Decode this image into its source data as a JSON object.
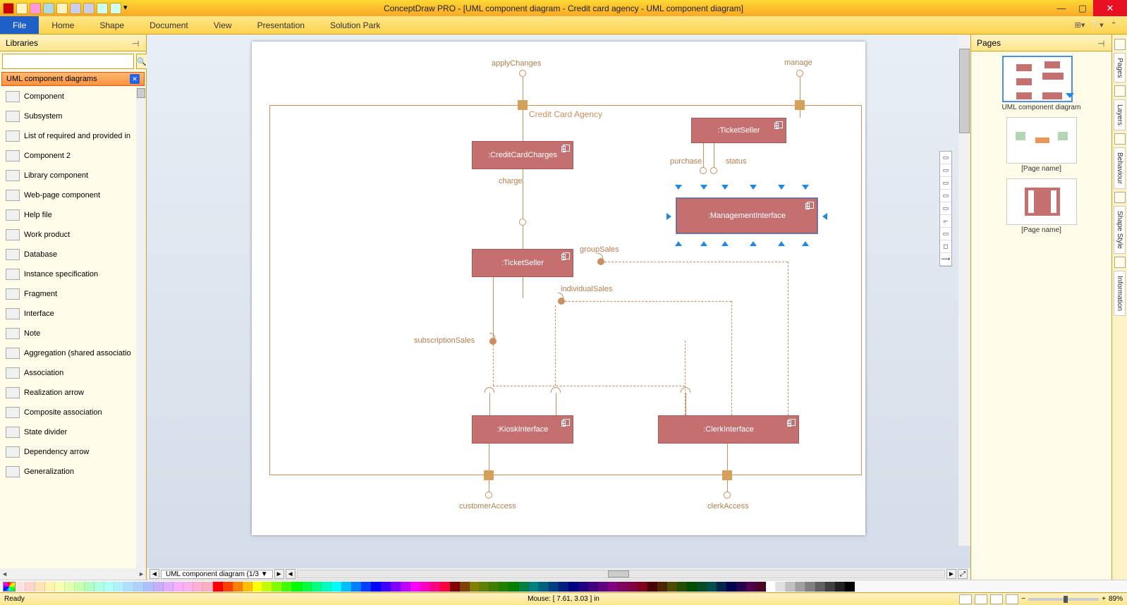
{
  "app_title": "ConceptDraw PRO - [UML component diagram - Credit card agency - UML component diagram]",
  "menu": {
    "file": "File",
    "tabs": [
      "Home",
      "Shape",
      "Document",
      "View",
      "Presentation",
      "Solution Park"
    ]
  },
  "libraries": {
    "title": "Libraries",
    "search_placeholder": "",
    "group": "UML component diagrams",
    "items": [
      "Component",
      "Subsystem",
      "List of required and provided in",
      "Component 2",
      "Library component",
      "Web-page component",
      "Help file",
      "Work product",
      "Database",
      "Instance specification",
      "Fragment",
      "Interface",
      "Note",
      "Aggregation (shared associatio",
      "Association",
      "Realization arrow",
      "Composite association",
      "State divider",
      "Dependency arrow",
      "Generalization"
    ]
  },
  "diagram": {
    "frame_title": "Credit Card Agency",
    "labels": {
      "apply": "applyChanges",
      "manage": "manage",
      "charge": "charge",
      "purchase": "purchase",
      "status": "status",
      "group": "groupSales",
      "individual": "individualSales",
      "subscription": "subscriptionSales",
      "customer": "customerAccess",
      "clerk": "clerkAccess"
    },
    "components": {
      "ccc": ":CreditCardCharges",
      "ts1": ":TicketSeller",
      "mi": ":ManagementInterface",
      "ts2": ":TicketSeller",
      "ki": ":KioskInterface",
      "ci": ":ClerkInterface"
    }
  },
  "sheet_tab": "UML component diagram (1/3",
  "pages": {
    "title": "Pages",
    "thumbs": [
      "UML component diagram",
      "[Page name]",
      "[Page name]"
    ]
  },
  "right_tabs": [
    "Pages",
    "Layers",
    "Behaviour",
    "Shape Style",
    "Information"
  ],
  "status": {
    "ready": "Ready",
    "mouse": "Mouse: [ 7.61, 3.03 ] in",
    "zoom": "89%"
  },
  "palette": [
    "#fde2e2",
    "#fcd5ce",
    "#ffe5b4",
    "#fff3b0",
    "#f8ffb0",
    "#e0ffb0",
    "#c8ffb0",
    "#b0ffc0",
    "#b0ffe0",
    "#b0fff8",
    "#b0f0ff",
    "#b0e0ff",
    "#b0d0ff",
    "#b0c0ff",
    "#c8b0ff",
    "#e0b0ff",
    "#f8b0ff",
    "#ffb0e8",
    "#ffb0d0",
    "#ffb0c0",
    "#ff0000",
    "#ff4000",
    "#ff8000",
    "#ffbf00",
    "#ffff00",
    "#bfff00",
    "#80ff00",
    "#40ff00",
    "#00ff00",
    "#00ff40",
    "#00ff80",
    "#00ffbf",
    "#00ffff",
    "#00bfff",
    "#0080ff",
    "#0040ff",
    "#0000ff",
    "#4000ff",
    "#8000ff",
    "#bf00ff",
    "#ff00ff",
    "#ff00bf",
    "#ff0080",
    "#ff0040",
    "#800000",
    "#804000",
    "#808000",
    "#608000",
    "#408000",
    "#208000",
    "#008000",
    "#008040",
    "#008080",
    "#006080",
    "#004080",
    "#002080",
    "#000080",
    "#200080",
    "#400080",
    "#600080",
    "#800080",
    "#800060",
    "#800040",
    "#800020",
    "#4d0000",
    "#4d2600",
    "#4d4d00",
    "#264d00",
    "#004d00",
    "#004d26",
    "#004d4d",
    "#00264d",
    "#00004d",
    "#26004d",
    "#4d004d",
    "#4d0026",
    "#ffffff",
    "#e0e0e0",
    "#c0c0c0",
    "#a0a0a0",
    "#808080",
    "#606060",
    "#404040",
    "#202020",
    "#000000"
  ]
}
